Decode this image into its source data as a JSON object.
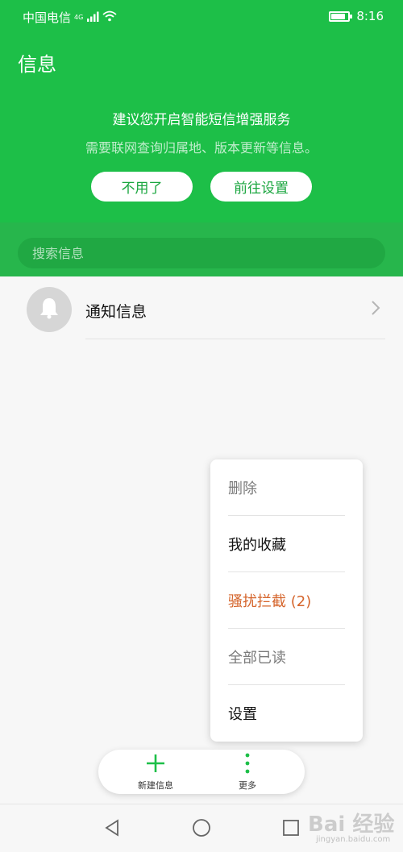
{
  "statusbar": {
    "carrier": "中国电信",
    "network": "4G",
    "time": "8:16",
    "battery_level": 0.75
  },
  "header": {
    "title": "信息"
  },
  "promo": {
    "title": "建议您开启智能短信增强服务",
    "subtitle": "需要联网查询归属地、版本更新等信息。",
    "decline_label": "不用了",
    "settings_label": "前往设置"
  },
  "search": {
    "placeholder": "搜索信息"
  },
  "conversations": [
    {
      "title": "通知信息",
      "icon": "bell-icon"
    }
  ],
  "menu": {
    "items": [
      {
        "label": "删除",
        "color": "#7a7a7a"
      },
      {
        "label": "我的收藏",
        "color": "#111111"
      },
      {
        "label": "骚扰拦截 (2)",
        "color": "#d5652c"
      },
      {
        "label": "全部已读",
        "color": "#7a7a7a"
      },
      {
        "label": "设置",
        "color": "#111111"
      }
    ]
  },
  "bottom_bar": {
    "new_label": "新建信息",
    "more_label": "更多"
  },
  "colors": {
    "accent": "#1dbf48",
    "warning": "#d5652c"
  },
  "watermark": {
    "logo": "Bai 经验",
    "url": "jingyan.baidu.com"
  }
}
